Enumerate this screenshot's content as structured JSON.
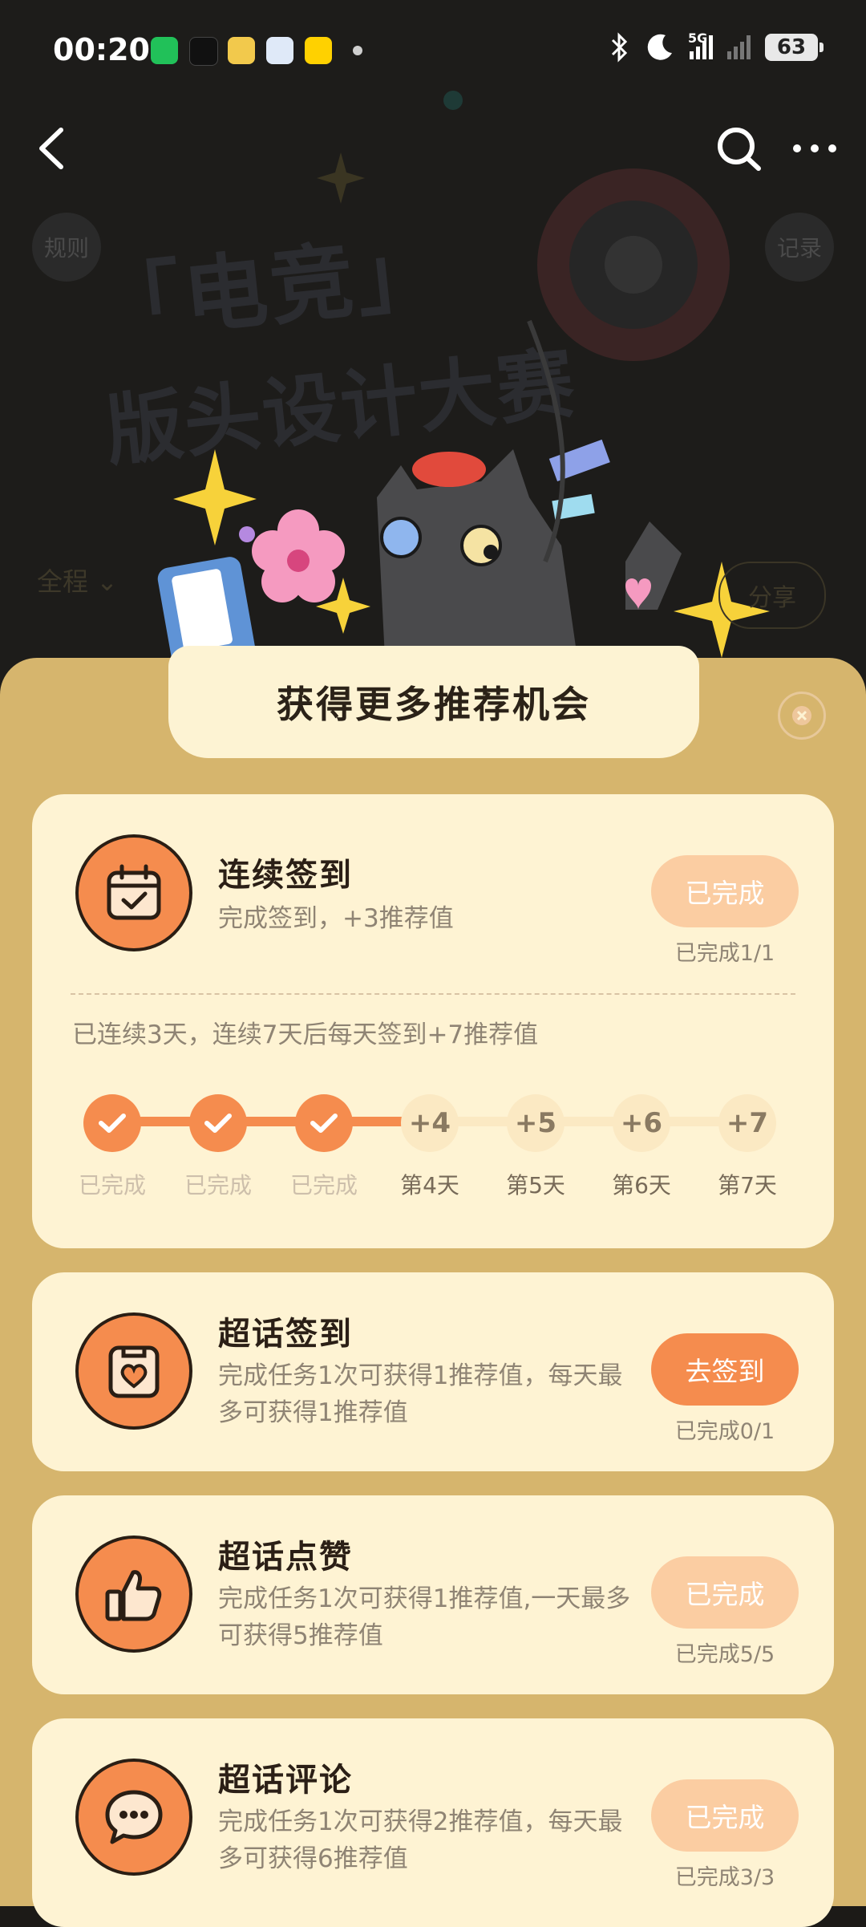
{
  "status_bar": {
    "time": "00:20",
    "network": "5G",
    "battery": "63"
  },
  "banner": {
    "deco_line1": "「电竞」",
    "deco_line2": "版头设计大赛",
    "rules_label": "规则",
    "record_label": "记录",
    "filter_label": "全程 ⌄",
    "share_label": "分享"
  },
  "sheet": {
    "title": "获得更多推荐机会"
  },
  "tasks": [
    {
      "title": "连续签到",
      "desc": "完成签到，+3推荐值",
      "button": "已完成",
      "count": "已完成1/1",
      "icon": "calendar-check-icon"
    },
    {
      "title": "超话签到",
      "desc": "完成任务1次可获得1推荐值，每天最多可获得1推荐值",
      "button": "去签到",
      "count": "已完成0/1",
      "icon": "heart-clipboard-icon"
    },
    {
      "title": "超话点赞",
      "desc": "完成任务1次可获得1推荐值,一天最多可获得5推荐值",
      "button": "已完成",
      "count": "已完成5/5",
      "icon": "thumbs-up-icon"
    },
    {
      "title": "超话评论",
      "desc": "完成任务1次可获得2推荐值，每天最多可获得6推荐值",
      "button": "已完成",
      "count": "已完成3/3",
      "icon": "comment-bubble-icon"
    }
  ],
  "streak": {
    "text": "已连续3天，连续7天后每天签到+7推荐值",
    "steps": [
      {
        "badge": "",
        "label": "已完成",
        "done": true
      },
      {
        "badge": "",
        "label": "已完成",
        "done": true
      },
      {
        "badge": "",
        "label": "已完成",
        "done": true
      },
      {
        "badge": "+4",
        "label": "第4天",
        "done": false
      },
      {
        "badge": "+5",
        "label": "第5天",
        "done": false
      },
      {
        "badge": "+6",
        "label": "第6天",
        "done": false
      },
      {
        "badge": "+7",
        "label": "第7天",
        "done": false
      }
    ]
  },
  "colors": {
    "accent": "#f58c4e",
    "accent_light": "#fbcda2",
    "card_bg": "#fef3d3",
    "sheet_bg": "#d6b56d"
  }
}
